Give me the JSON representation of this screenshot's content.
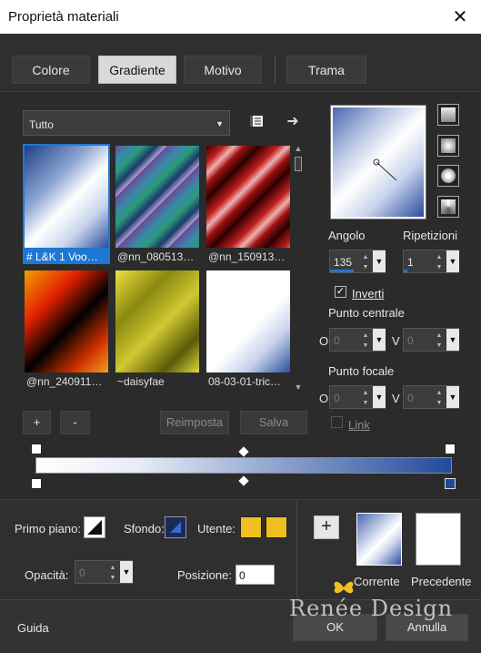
{
  "window": {
    "title": "Proprietà materiali",
    "close_icon": "close-icon"
  },
  "tabs": [
    {
      "label": "Colore",
      "active": false
    },
    {
      "label": "Gradiente",
      "active": true
    },
    {
      "label": "Motivo",
      "active": false
    },
    {
      "label": "Trama",
      "active": false
    }
  ],
  "category": {
    "value": "Tutto"
  },
  "gradients": [
    {
      "label": "# L&K 1 Voo…",
      "selected": true
    },
    {
      "label": "@nn_080513…",
      "selected": false
    },
    {
      "label": "@nn_150913…",
      "selected": false
    },
    {
      "label": "@nn_240911…",
      "selected": false
    },
    {
      "label": "~daisyfae",
      "selected": false
    },
    {
      "label": "08-03-01-tric…",
      "selected": false
    }
  ],
  "buttons": {
    "add": "+",
    "remove": "-",
    "reset": "Reimposta",
    "save": "Salva",
    "ok": "OK",
    "cancel": "Annulla",
    "help": "Guida",
    "add_user": "+"
  },
  "angle": {
    "label": "Angolo",
    "value": "135"
  },
  "repeats": {
    "label": "Ripetizioni",
    "value": "1"
  },
  "invert": {
    "label": "Inverti",
    "checked": true
  },
  "center": {
    "label": "Punto centrale",
    "o_label": "O",
    "v_label": "V",
    "o_value": "0",
    "v_value": "0"
  },
  "focal": {
    "label": "Punto focale",
    "o_label": "O",
    "v_label": "V",
    "o_value": "0",
    "v_value": "0"
  },
  "link": {
    "label": "Link",
    "checked": false
  },
  "bottom": {
    "foreground_label": "Primo piano:",
    "background_label": "Sfondo:",
    "user_label": "Utente:",
    "opacity_label": "Opacità:",
    "opacity_value": "0",
    "position_label": "Posizione:",
    "position_value": "0",
    "current_label": "Corrente",
    "previous_label": "Precedente"
  },
  "watermark": "Renée Design",
  "colors": {
    "accent": "#1e78d2",
    "gradient_dark": "#234a9a",
    "user_yellow": "#f0c020"
  }
}
